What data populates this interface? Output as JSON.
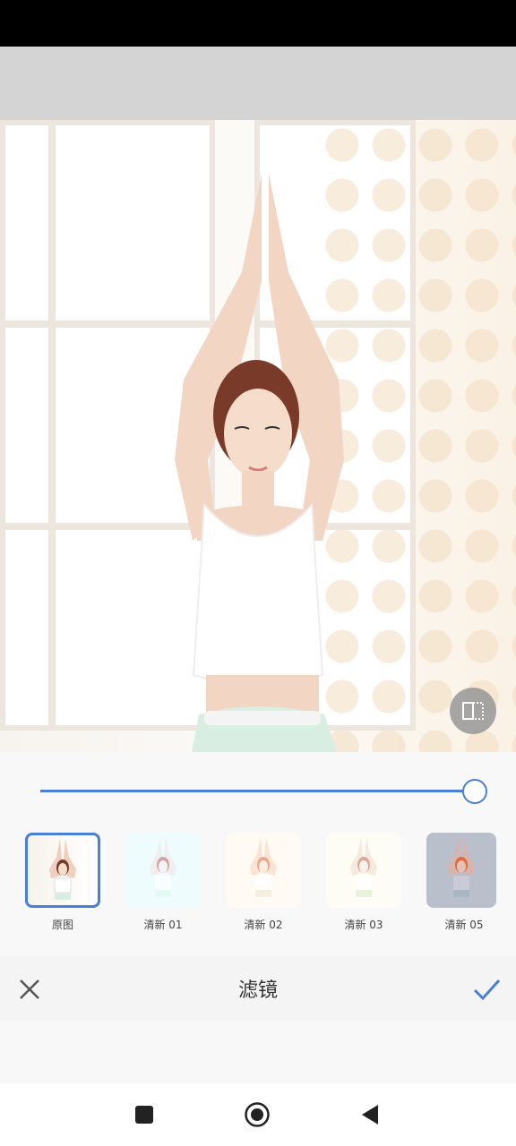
{
  "filters": [
    {
      "label": "原图",
      "selected": true
    },
    {
      "label": "清新 01",
      "selected": false
    },
    {
      "label": "清新 02",
      "selected": false
    },
    {
      "label": "清新 03",
      "selected": false
    },
    {
      "label": "清新 05",
      "selected": false
    }
  ],
  "slider": {
    "value_percent": 100
  },
  "bottom": {
    "title": "滤镜"
  },
  "icons": {
    "compare": "compare-icon",
    "close": "close-icon",
    "confirm": "check-icon",
    "nav_recent": "square-icon",
    "nav_home": "circle-icon",
    "nav_back": "back-triangle-icon"
  },
  "colors": {
    "accent": "#4a7fd6"
  }
}
